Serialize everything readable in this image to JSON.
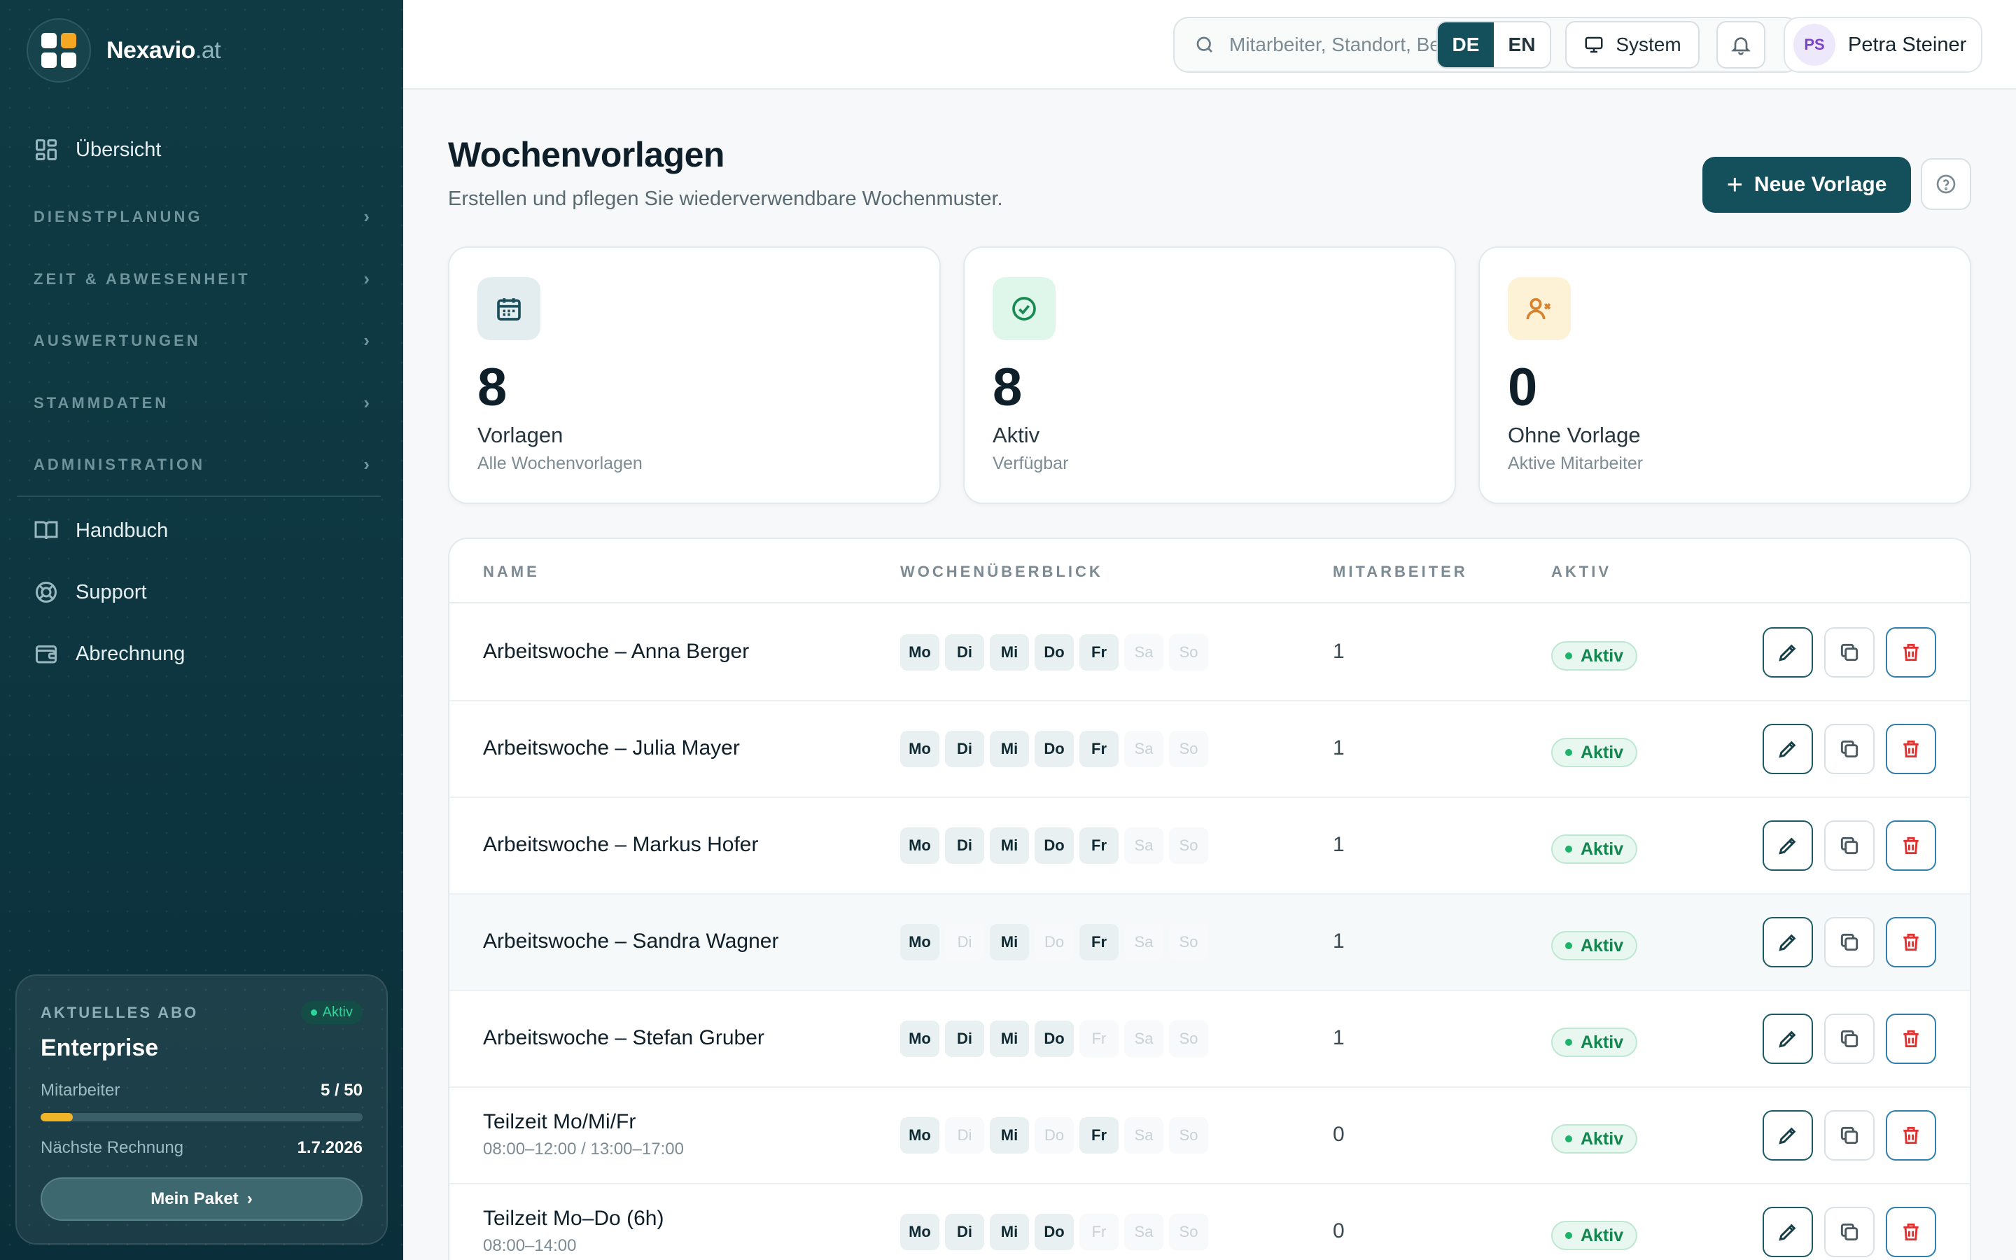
{
  "brand": {
    "name": "Nexavio",
    "tld": ".at"
  },
  "sidebar": {
    "overview": "Übersicht",
    "groups": [
      "DIENSTPLANUNG",
      "ZEIT & ABWESENHEIT",
      "AUSWERTUNGEN",
      "STAMMDATEN",
      "ADMINISTRATION"
    ],
    "links": [
      "Handbuch",
      "Support",
      "Abrechnung"
    ],
    "subscription": {
      "label": "AKTUELLES ABO",
      "status": "Aktiv",
      "plan": "Enterprise",
      "employees_label": "Mitarbeiter",
      "employees_value": "5 / 50",
      "employees_used": 5,
      "employees_max": 50,
      "next_invoice_label": "Nächste Rechnung",
      "next_invoice_date": "1.7.2026",
      "button": "Mein Paket"
    }
  },
  "topbar": {
    "search_placeholder": "Mitarbeiter, Standort, Beruf suchen...",
    "lang": [
      "DE",
      "EN"
    ],
    "lang_active": "DE",
    "theme": "System",
    "user": {
      "initials": "PS",
      "name": "Petra Steiner"
    }
  },
  "page": {
    "title": "Wochenvorlagen",
    "subtitle": "Erstellen und pflegen Sie wiederverwendbare Wochenmuster.",
    "new_button": "Neue Vorlage"
  },
  "stats": [
    {
      "value": "8",
      "label": "Vorlagen",
      "sub": "Alle Wochenvorlagen",
      "icon": "calendar-icon",
      "icon_bg": "#e3edf0",
      "icon_color": "#1c4f5a"
    },
    {
      "value": "8",
      "label": "Aktiv",
      "sub": "Verfügbar",
      "icon": "check-circle-icon",
      "icon_bg": "#dff6ea",
      "icon_color": "#1a8a55"
    },
    {
      "value": "0",
      "label": "Ohne Vorlage",
      "sub": "Aktive Mitarbeiter",
      "icon": "user-x-icon",
      "icon_bg": "#fdf1d6",
      "icon_color": "#d9822b"
    }
  ],
  "table": {
    "headers": [
      "NAME",
      "WOCHENÜBERBLICK",
      "MITARBEITER",
      "AKTIV"
    ],
    "day_labels": [
      "Mo",
      "Di",
      "Mi",
      "Do",
      "Fr",
      "Sa",
      "So"
    ],
    "rows": [
      {
        "name": "Arbeitswoche – Anna Berger",
        "time": "",
        "days": [
          1,
          1,
          1,
          1,
          1,
          0,
          0
        ],
        "count": "1",
        "status": "Aktiv"
      },
      {
        "name": "Arbeitswoche – Julia Mayer",
        "time": "",
        "days": [
          1,
          1,
          1,
          1,
          1,
          0,
          0
        ],
        "count": "1",
        "status": "Aktiv"
      },
      {
        "name": "Arbeitswoche – Markus Hofer",
        "time": "",
        "days": [
          1,
          1,
          1,
          1,
          1,
          0,
          0
        ],
        "count": "1",
        "status": "Aktiv"
      },
      {
        "name": "Arbeitswoche – Sandra Wagner",
        "time": "",
        "days": [
          1,
          0,
          1,
          0,
          1,
          0,
          0
        ],
        "count": "1",
        "status": "Aktiv"
      },
      {
        "name": "Arbeitswoche – Stefan Gruber",
        "time": "",
        "days": [
          1,
          1,
          1,
          1,
          0,
          0,
          0
        ],
        "count": "1",
        "status": "Aktiv"
      },
      {
        "name": "Teilzeit Mo/Mi/Fr",
        "time": "08:00–12:00 / 13:00–17:00",
        "days": [
          1,
          0,
          1,
          0,
          1,
          0,
          0
        ],
        "count": "0",
        "status": "Aktiv"
      },
      {
        "name": "Teilzeit Mo–Do (6h)",
        "time": "08:00–14:00",
        "days": [
          1,
          1,
          1,
          1,
          0,
          0,
          0
        ],
        "count": "0",
        "status": "Aktiv"
      }
    ]
  }
}
